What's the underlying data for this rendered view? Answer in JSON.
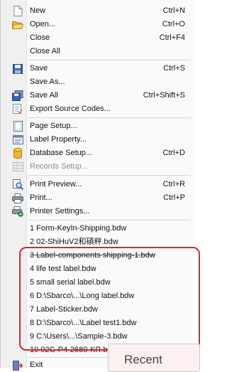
{
  "menu": {
    "items": [
      {
        "id": "new",
        "label": "New",
        "shortcut": "Ctrl+N",
        "icon": "new-file-icon",
        "enabled": true
      },
      {
        "id": "open",
        "label": "Open...",
        "shortcut": "Ctrl+O",
        "icon": "open-folder-icon",
        "enabled": true
      },
      {
        "id": "close",
        "label": "Close",
        "shortcut": "Ctrl+F4",
        "icon": "",
        "enabled": true
      },
      {
        "id": "close-all",
        "label": "Close All",
        "shortcut": "",
        "icon": "",
        "enabled": true
      },
      {
        "id": "save",
        "label": "Save",
        "shortcut": "Ctrl+S",
        "icon": "save-disk-icon",
        "enabled": true
      },
      {
        "id": "save-as",
        "label": "Save As...",
        "shortcut": "",
        "icon": "",
        "enabled": true
      },
      {
        "id": "save-all",
        "label": "Save All",
        "shortcut": "Ctrl+Shift+S",
        "icon": "save-all-icon",
        "enabled": true
      },
      {
        "id": "export-source-codes",
        "label": "Export Source Codes...",
        "shortcut": "",
        "icon": "export-icon",
        "enabled": true
      },
      {
        "id": "page-setup",
        "label": "Page Setup...",
        "shortcut": "",
        "icon": "page-setup-icon",
        "enabled": true
      },
      {
        "id": "label-property",
        "label": "Label Property...",
        "shortcut": "",
        "icon": "label-property-icon",
        "enabled": true
      },
      {
        "id": "database-setup",
        "label": "Database Setup...",
        "shortcut": "Ctrl+D",
        "icon": "database-icon",
        "enabled": true
      },
      {
        "id": "records-setup",
        "label": "Records Setup...",
        "shortcut": "",
        "icon": "records-icon",
        "enabled": false
      },
      {
        "id": "print-preview",
        "label": "Print Preview...",
        "shortcut": "Ctrl+R",
        "icon": "print-preview-icon",
        "enabled": true
      },
      {
        "id": "print",
        "label": "Print...",
        "shortcut": "Ctrl+P",
        "icon": "printer-icon",
        "enabled": true
      },
      {
        "id": "printer-settings",
        "label": "Printer Settings...",
        "shortcut": "",
        "icon": "printer-settings-icon",
        "enabled": true
      }
    ],
    "recent_files": [
      "1 Form-KeyIn-Shipping.bdw",
      "2 02-ShiHuV2和碩秤.bdw",
      "3 Label-components shipping-1.bdw",
      "4 life test label.bdw",
      "5 small serial label.bdw",
      "6 D:\\Sbarco\\...\\Long label.bdw",
      "7 Label-Sticker.bdw",
      "8 D:\\Sbarco\\...\\Label test1.bdw",
      "9 C:\\Users\\...\\Sample-3.bdw",
      "10 02G-P4-2680-KR.bdw"
    ],
    "exit": {
      "label": "Exit",
      "icon": "exit-icon"
    }
  },
  "annotation": {
    "callout_text": "Recent",
    "highlight_color": "#d9262b"
  }
}
